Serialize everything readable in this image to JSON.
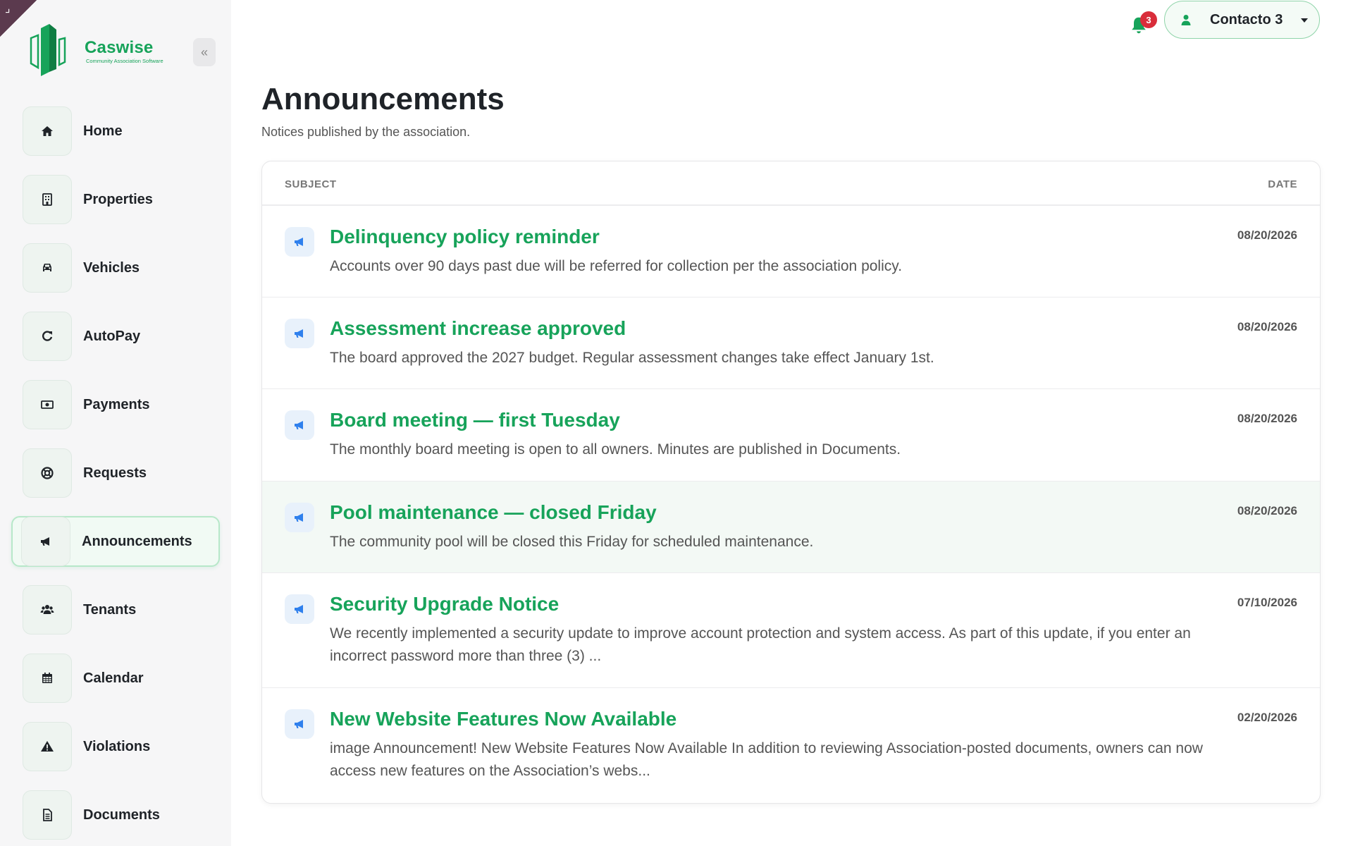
{
  "brand": {
    "name": "Caswise",
    "tagline": "Community Association Software"
  },
  "sidebar": {
    "collapse_icon": "double-chevron-left-icon",
    "items": [
      {
        "label": "Home",
        "icon": "home-icon",
        "active": false
      },
      {
        "label": "Properties",
        "icon": "building-icon",
        "active": false
      },
      {
        "label": "Vehicles",
        "icon": "car-icon",
        "active": false
      },
      {
        "label": "AutoPay",
        "icon": "refresh-icon",
        "active": false
      },
      {
        "label": "Payments",
        "icon": "money-icon",
        "active": false
      },
      {
        "label": "Requests",
        "icon": "lifebuoy-icon",
        "active": false
      },
      {
        "label": "Announcements",
        "icon": "megaphone-icon",
        "active": true
      },
      {
        "label": "Tenants",
        "icon": "users-icon",
        "active": false
      },
      {
        "label": "Calendar",
        "icon": "calendar-icon",
        "active": false
      },
      {
        "label": "Violations",
        "icon": "warning-icon",
        "active": false
      },
      {
        "label": "Documents",
        "icon": "document-icon",
        "active": false
      }
    ]
  },
  "header": {
    "notifications_count": "3",
    "user_name": "Contacto 3"
  },
  "main": {
    "title": "Announcements",
    "subtitle": "Notices published by the association.",
    "columns": {
      "subject": "SUBJECT",
      "date": "DATE"
    },
    "announcements": [
      {
        "title": "Delinquency policy reminder",
        "desc": "Accounts over 90 days past due will be referred for collection per the association policy.",
        "date": "08/20/2026"
      },
      {
        "title": "Assessment increase approved",
        "desc": "The board approved the 2027 budget. Regular assessment changes take effect January 1st.",
        "date": "08/20/2026"
      },
      {
        "title": "Board meeting — first Tuesday",
        "desc": "The monthly board meeting is open to all owners. Minutes are published in Documents.",
        "date": "08/20/2026"
      },
      {
        "title": "Pool maintenance — closed Friday",
        "desc": "The community pool will be closed this Friday for scheduled maintenance.",
        "date": "08/20/2026"
      },
      {
        "title": "Security Upgrade Notice",
        "desc": "We recently implemented a security update to improve account protection and system access. As part of this update, if you enter an incorrect password more than three (3) ...",
        "date": "07/10/2026"
      },
      {
        "title": "New Website Features Now Available",
        "desc": "image Announcement! New Website Features Now Available In addition to reviewing Association-posted documents, owners can now access new features on the Association’s webs...",
        "date": "02/20/2026"
      }
    ]
  },
  "colors": {
    "accent": "#17a35a",
    "badge": "#d92d3a",
    "icon_blue": "#2f80ed"
  }
}
